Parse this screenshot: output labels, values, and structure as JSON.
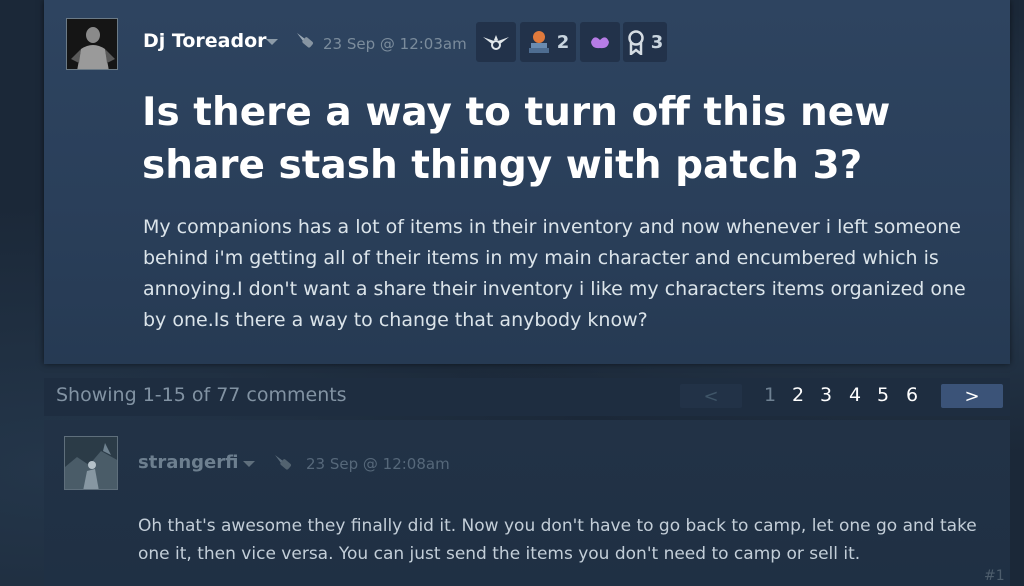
{
  "post": {
    "author": "Dj Toreador",
    "date": "23 Sep @ 12:03am",
    "badges": [
      {
        "icon": "winged-emblem-icon",
        "count": ""
      },
      {
        "icon": "award-pedestal-icon",
        "count": "2"
      },
      {
        "icon": "purple-creature-icon",
        "count": ""
      },
      {
        "icon": "ribbon-medal-icon",
        "count": "3"
      }
    ],
    "title": "Is there a way to turn off this new share stash thingy with patch 3?",
    "body": "My companions has a lot of items in their inventory and now whenever i left someone behind i'm getting all of their items in my main character and encumbered which is annoying.I don't want a share their inventory i like my characters items organized one by one.Is there a way to change that anybody know?"
  },
  "pagination": {
    "showing": "Showing 1-15 of 77 comments",
    "prev_label": "<",
    "next_label": ">",
    "pages": [
      "1",
      "2",
      "3",
      "4",
      "5",
      "6"
    ],
    "current_page": "1"
  },
  "comment": {
    "author": "strangerfi",
    "date": "23 Sep @ 12:08am",
    "body": "Oh that's awesome they finally did it. Now you don't have to go back to camp, let one go and take one it, then vice versa. You can just send the items you don't need to camp or sell it.",
    "number": "#1"
  },
  "colors": {
    "post_bg": "#2e4460",
    "page_bg": "#1b2838",
    "next_button": "#3b5378"
  }
}
